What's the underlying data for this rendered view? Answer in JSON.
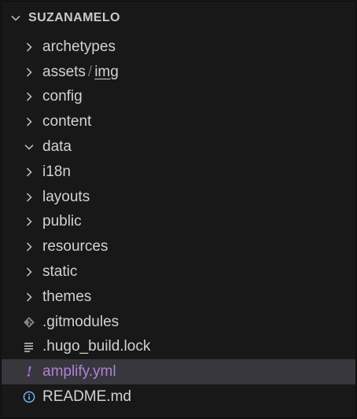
{
  "explorer": {
    "root_title": "SUZANAMELO",
    "root_chevron_icon": "chevron-down-icon",
    "items": [
      {
        "type": "folder",
        "label": "archetypes",
        "expanded": false,
        "icon": "chevron-right-icon"
      },
      {
        "type": "folder",
        "label_part1": "assets",
        "separator": "/",
        "label_part2": "img",
        "expanded": false,
        "icon": "chevron-right-icon"
      },
      {
        "type": "folder",
        "label": "config",
        "expanded": false,
        "icon": "chevron-right-icon"
      },
      {
        "type": "folder",
        "label": "content",
        "expanded": false,
        "icon": "chevron-right-icon"
      },
      {
        "type": "folder",
        "label": "data",
        "expanded": true,
        "icon": "chevron-down-icon"
      },
      {
        "type": "folder",
        "label": "i18n",
        "expanded": false,
        "icon": "chevron-right-icon"
      },
      {
        "type": "folder",
        "label": "layouts",
        "expanded": false,
        "icon": "chevron-right-icon"
      },
      {
        "type": "folder",
        "label": "public",
        "expanded": false,
        "icon": "chevron-right-icon"
      },
      {
        "type": "folder",
        "label": "resources",
        "expanded": false,
        "icon": "chevron-right-icon"
      },
      {
        "type": "folder",
        "label": "static",
        "expanded": false,
        "icon": "chevron-right-icon"
      },
      {
        "type": "folder",
        "label": "themes",
        "expanded": false,
        "icon": "chevron-right-icon"
      },
      {
        "type": "file",
        "label": ".gitmodules",
        "icon": "git-icon"
      },
      {
        "type": "file",
        "label": ".hugo_build.lock",
        "icon": "text-lines-icon"
      },
      {
        "type": "file",
        "label": "amplify.yml",
        "icon": "exclamation-icon",
        "selected": true
      },
      {
        "type": "file",
        "label": "README.md",
        "icon": "info-icon"
      }
    ]
  },
  "colors": {
    "background": "#181818",
    "text": "#d2d2d2",
    "selected_background": "#37373d",
    "selected_text": "#b180d7",
    "yaml_icon": "#a370e0",
    "info_icon": "#75beff"
  }
}
